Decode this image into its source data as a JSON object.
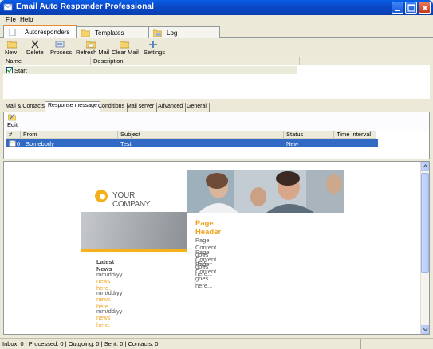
{
  "window": {
    "title": "Email Auto Responder Professional",
    "accent": "#0b49c9"
  },
  "menu": [
    "File",
    "Help"
  ],
  "top_tabs": [
    {
      "label": "Autoresponders",
      "icon": "document-icon",
      "active": true
    },
    {
      "label": "Templates",
      "icon": "folder-icon",
      "active": false
    },
    {
      "label": "Log",
      "icon": "log-icon",
      "active": false
    }
  ],
  "toolbar": {
    "new": "New",
    "delete": "Delete",
    "process": "Process",
    "refresh_mail": "Refresh Mail",
    "clear_mail": "Clear Mail",
    "settings": "Settings"
  },
  "autoresponders": {
    "columns": [
      "Name",
      "Description"
    ],
    "rows": [
      {
        "checked": true,
        "name": "Start",
        "description": ""
      }
    ]
  },
  "bottom_tabs": [
    "Mail & Contacts",
    "Response message",
    "Conditions",
    "Mail server",
    "Advanced",
    "General"
  ],
  "active_bottom_tab": "Response message",
  "edit_label": "Edit",
  "messages": {
    "columns": [
      "#",
      "From",
      "Subject",
      "Status",
      "Time Interval"
    ],
    "rows": [
      {
        "num": "0",
        "from": "Somebody",
        "subject": "Test",
        "status": "New",
        "interval": ""
      }
    ],
    "selection_color": "#316ac5"
  },
  "preview": {
    "logo_prefix": "YOUR ",
    "logo_name": "COMPANY",
    "page_header": "Page Header",
    "page_content": [
      "Page Content goes here...",
      "Page Content goes here...",
      "Page Content goes here..."
    ],
    "latest_news": "Latest News",
    "news": [
      {
        "date": "mm/dd/yy",
        "text": "news here."
      },
      {
        "date": "mm/dd/yy",
        "text": "news here."
      },
      {
        "date": "mm/dd/yy",
        "text": "news here."
      }
    ],
    "accent": "#f5b11b"
  },
  "status": "Inbox: 0  |  Processed: 0  |  Outgoing: 0  |  Sent: 0  |  Contacts: 0"
}
